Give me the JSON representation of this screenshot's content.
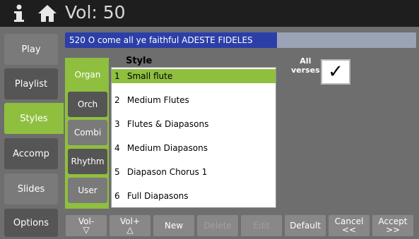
{
  "header": {
    "info_icon": "info-icon",
    "home_icon": "home-icon",
    "volume_text": "Vol: 50"
  },
  "nav": {
    "items": [
      {
        "label": "Play"
      },
      {
        "label": "Playlist"
      },
      {
        "label": "Styles"
      },
      {
        "label": "Accomp"
      },
      {
        "label": "Slides"
      },
      {
        "label": "Options"
      }
    ]
  },
  "hymn": {
    "title": "520  O come all ye faithful  ADESTE FIDELES"
  },
  "categories": [
    {
      "label": "Organ"
    },
    {
      "label": "Orch"
    },
    {
      "label": "Combi"
    },
    {
      "label": "Rhythm"
    },
    {
      "label": "User"
    }
  ],
  "style_list": {
    "header": "Style",
    "rows": [
      {
        "num": "1",
        "name": "Small flute"
      },
      {
        "num": "2",
        "name": "Medium Flutes"
      },
      {
        "num": "3",
        "name": "Flutes & Diapasons"
      },
      {
        "num": "4",
        "name": "Medium Diapasons"
      },
      {
        "num": "5",
        "name": "Diapason Chorus 1"
      },
      {
        "num": "6",
        "name": "Full Diapasons"
      }
    ]
  },
  "all_verses": {
    "label_line1": "All",
    "label_line2": "verses",
    "checked_symbol": "✓"
  },
  "bottom_bar": {
    "vol_minus": {
      "label": "Vol-",
      "sub": "▽"
    },
    "vol_plus": {
      "label": "Vol+",
      "sub": "△"
    },
    "new": "New",
    "delete": "Delete",
    "edit": "Edit",
    "default": "Default",
    "cancel": {
      "label": "Cancel",
      "sub": "<<"
    },
    "accept": {
      "label": "Accept",
      "sub": ">>"
    }
  },
  "colors": {
    "accent_green": "#8fbf3f",
    "title_blue": "#2c3ea8",
    "panel_gray": "#6e6e6e",
    "topbar": "#1e1e1e"
  }
}
